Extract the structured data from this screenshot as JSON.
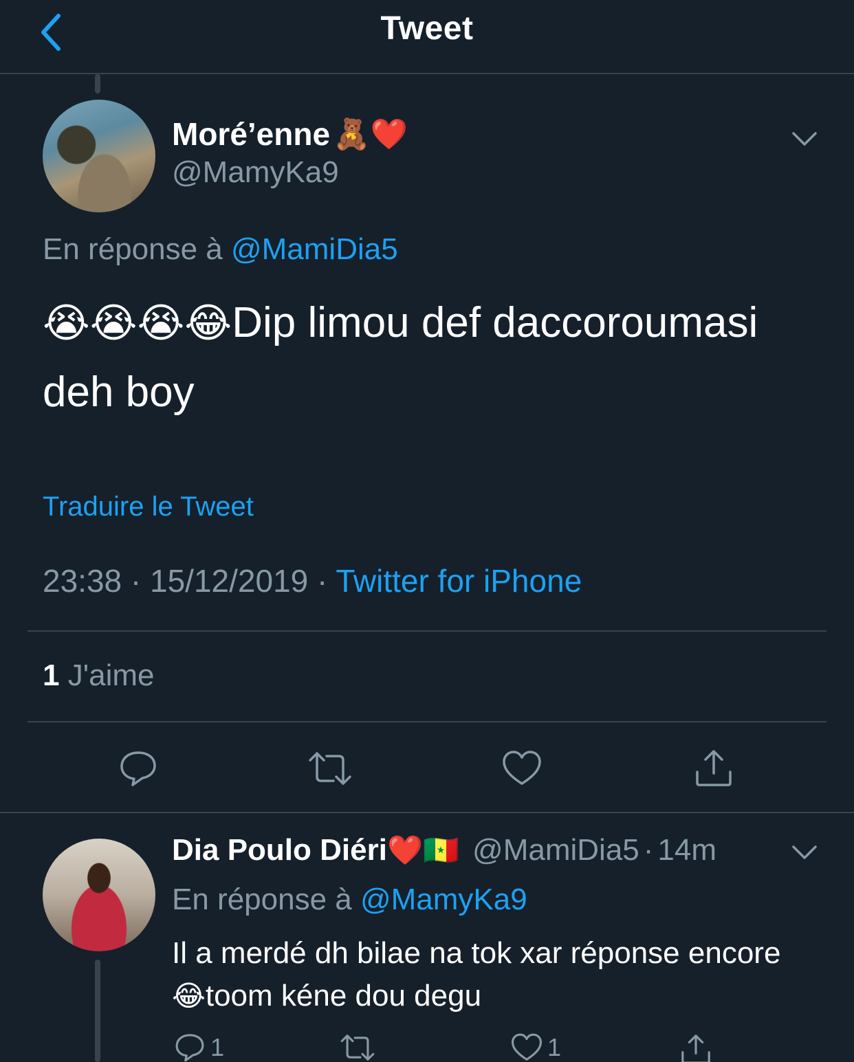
{
  "header": {
    "title": "Tweet"
  },
  "main_tweet": {
    "display_name": "Moré’enne",
    "name_emojis": "🧸❤️",
    "handle": "@MamyKa9",
    "reply_prefix": "En réponse à",
    "reply_to": "@MamiDia5",
    "text_emojis": "😭😭😭😂",
    "text": "Dip limou def daccoroumasi deh boy",
    "translate_label": "Traduire le Tweet",
    "time": "23:38",
    "date": "15/12/2019",
    "separator": "·",
    "source": "Twitter for iPhone",
    "likes_count": "1",
    "likes_label": "J'aime"
  },
  "reply_tweet": {
    "display_name": "Dia Poulo Diéri",
    "name_emojis": "❤️🇸🇳",
    "handle": "@MamiDia5",
    "separator": "·",
    "time_ago": "14m",
    "reply_prefix": "En réponse à",
    "reply_to": "@MamyKa9",
    "text_part1": "Il a merdé dh bilae na tok xar réponse encore",
    "text_emoji": "😂",
    "text_part2": "toom kéne dou degu",
    "reply_count": "1",
    "like_count": "1"
  },
  "colors": {
    "background": "#15202b",
    "accent": "#1da1f2",
    "secondary_text": "#8899a6",
    "divider": "#38444d"
  },
  "icons": [
    "back-chevron-icon",
    "chevron-down-icon",
    "reply-icon",
    "retweet-icon",
    "like-icon",
    "share-icon"
  ]
}
